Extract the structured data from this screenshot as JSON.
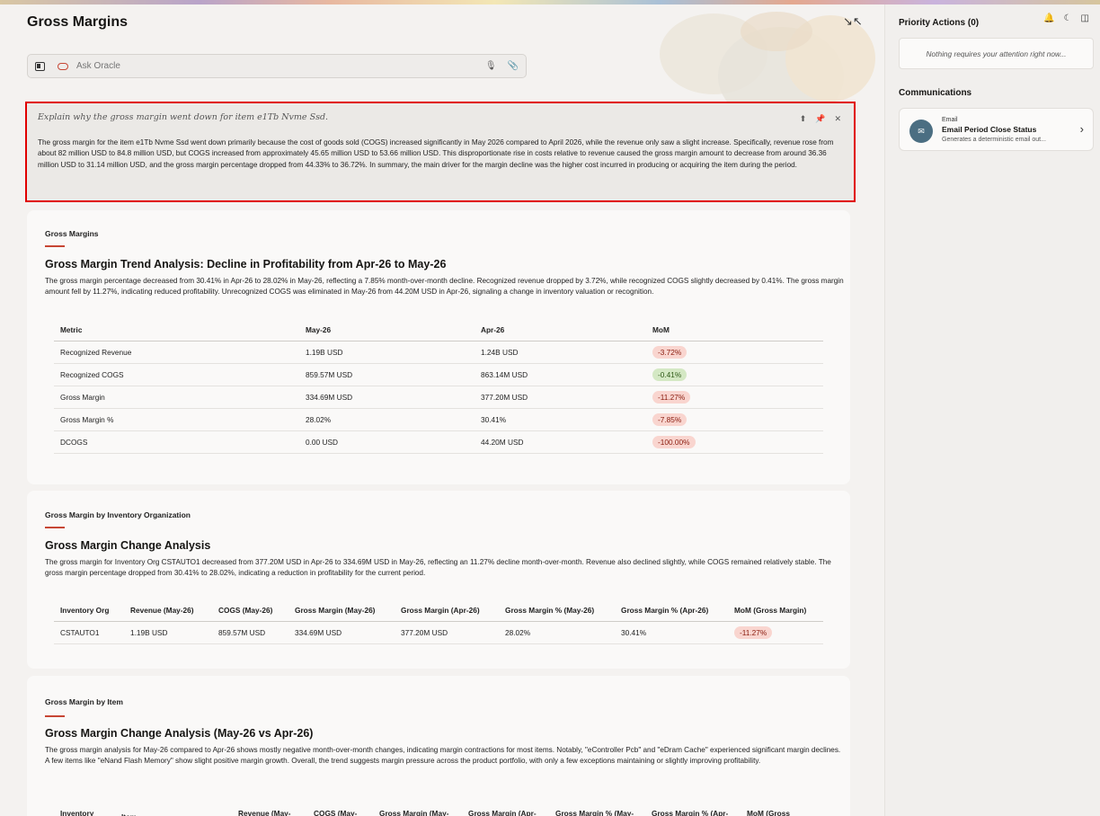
{
  "header": {
    "title": "Gross Margins"
  },
  "ask": {
    "placeholder": "Ask Oracle"
  },
  "ai_response": {
    "question": "Explain why the gross margin went down for item e1Tb Nvme Ssd.",
    "answer": "The gross margin for the item e1Tb Nvme Ssd went down primarily because the cost of goods sold (COGS) increased significantly in May 2026 compared to April 2026, while the revenue only saw a slight increase. Specifically, revenue rose from about 82 million USD to 84.8 million USD, but COGS increased from approximately 45.65 million USD to 53.66 million USD. This disproportionate rise in costs relative to revenue caused the gross margin amount to decrease from around 36.36 million USD to 31.14 million USD, and the gross margin percentage dropped from 44.33% to 36.72%. In summary, the main driver for the margin decline was the higher cost incurred in producing or acquiring the item during the period."
  },
  "card1": {
    "eyebrow": "Gross Margins",
    "heading": "Gross Margin Trend Analysis: Decline in Profitability from Apr-26 to May-26",
    "desc": "The gross margin percentage decreased from 30.41% in Apr-26 to 28.02% in May-26, reflecting a 7.85% month-over-month decline. Recognized revenue dropped by 3.72%, while recognized COGS slightly decreased by 0.41%. The gross margin amount fell by 11.27%, indicating reduced profitability. Unrecognized COGS was eliminated in May-26 from 44.20M USD in Apr-26, signaling a change in inventory valuation or recognition.",
    "columns": [
      "Metric",
      "May-26",
      "Apr-26",
      "MoM"
    ],
    "rows": [
      [
        "Recognized Revenue",
        "1.19B USD",
        "1.24B USD",
        "-3.72%"
      ],
      [
        "Recognized COGS",
        "859.57M USD",
        "863.14M USD",
        "-0.41%"
      ],
      [
        "Gross Margin",
        "334.69M USD",
        "377.20M USD",
        "-11.27%"
      ],
      [
        "Gross Margin %",
        "28.02%",
        "30.41%",
        "-7.85%"
      ],
      [
        "DCOGS",
        "0.00 USD",
        "44.20M USD",
        "-100.00%"
      ]
    ]
  },
  "card2": {
    "eyebrow": "Gross Margin by Inventory Organization",
    "heading": "Gross Margin Change Analysis",
    "desc": "The gross margin for Inventory Org CSTAUTO1 decreased from 377.20M USD in Apr-26 to 334.69M USD in May-26, reflecting an 11.27% decline month-over-month. Revenue also declined slightly, while COGS remained relatively stable. The gross margin percentage dropped from 30.41% to 28.02%, indicating a reduction in profitability for the current period.",
    "columns": [
      "Inventory Org",
      "Revenue (May-26)",
      "COGS (May-26)",
      "Gross Margin (May-26)",
      "Gross Margin (Apr-26)",
      "Gross Margin % (May-26)",
      "Gross Margin % (Apr-26)",
      "MoM (Gross Margin)"
    ],
    "rows": [
      [
        "CSTAUTO1",
        "1.19B USD",
        "859.57M USD",
        "334.69M USD",
        "377.20M USD",
        "28.02%",
        "30.41%",
        "-11.27%"
      ]
    ]
  },
  "card3": {
    "eyebrow": "Gross Margin by Item",
    "heading": "Gross Margin Change Analysis (May-26 vs Apr-26)",
    "desc": "The gross margin analysis for May-26 compared to Apr-26 shows mostly negative month-over-month changes, indicating margin contractions for most items. Notably, \"eController Pcb\" and \"eDram Cache\" experienced significant margin declines. A few items like \"eNand Flash Memory\" show slight positive margin growth. Overall, the trend suggests margin pressure across the product portfolio, with only a few exceptions maintaining or slightly improving profitability.",
    "columns": [
      "Inventory",
      "Item",
      "Revenue (May-",
      "COGS (May-",
      "Gross Margin (May-",
      "Gross Margin (Apr-",
      "Gross Margin % (May-",
      "Gross Margin % (Apr-",
      "MoM (Gross"
    ]
  },
  "side": {
    "priority_title": "Priority Actions (0)",
    "empty_text": "Nothing requires your attention right now...",
    "comm_title": "Communications",
    "comm_kind": "Email",
    "comm_name": "Email Period Close Status",
    "comm_sub": "Generates a deterministic email out..."
  },
  "colors": {
    "accent": "#c74634",
    "highlight_border": "#e00000",
    "neg_pill": "#f9d5cf",
    "pos_pill": "#d4e8c4"
  }
}
